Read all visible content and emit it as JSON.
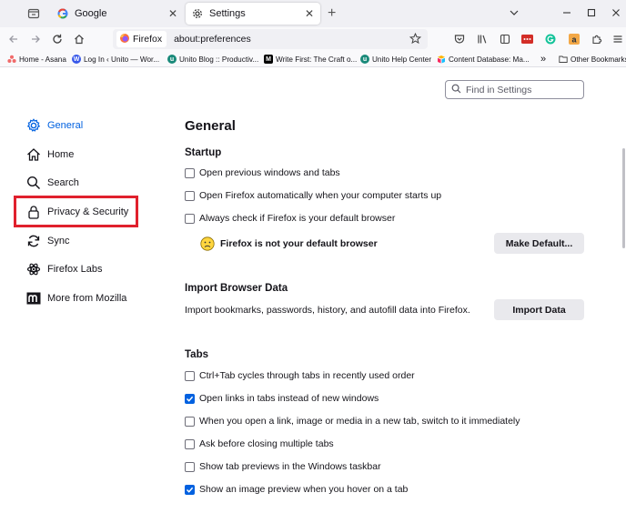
{
  "tabs": [
    {
      "label": "Google",
      "icon": "google-icon",
      "active": false
    },
    {
      "label": "Settings",
      "icon": "gear-icon",
      "active": true
    }
  ],
  "navbar": {
    "identity_label": "Firefox",
    "url": "about:preferences"
  },
  "bookmarks": [
    {
      "label": "Home - Asana",
      "icon": "asana-icon",
      "color": "#f06a6a"
    },
    {
      "label": "Log In ‹ Unito — Wor...",
      "icon": "wordpress-icon",
      "color": "#3858e9"
    },
    {
      "label": "Unito Blog :: Productiv...",
      "icon": "unito-icon",
      "color": "#1a8a7a"
    },
    {
      "label": "Write First: The Craft o...",
      "icon": "medium-icon",
      "color": "#000000"
    },
    {
      "label": "Unito Help Center",
      "icon": "unito-icon",
      "color": "#1a8a7a"
    },
    {
      "label": "Content Database: Ma...",
      "icon": "airtable-icon",
      "color": "#fcb400"
    }
  ],
  "bookmarks_other": "Other Bookmarks",
  "search": {
    "placeholder": "Find in Settings"
  },
  "sidebar": {
    "items": [
      {
        "label": "General",
        "icon": "gear-icon",
        "selected": true
      },
      {
        "label": "Home",
        "icon": "home-icon",
        "selected": false
      },
      {
        "label": "Search",
        "icon": "search-icon",
        "selected": false
      },
      {
        "label": "Privacy & Security",
        "icon": "lock-icon",
        "selected": false
      },
      {
        "label": "Sync",
        "icon": "sync-icon",
        "selected": false
      },
      {
        "label": "Firefox Labs",
        "icon": "labs-icon",
        "selected": false
      },
      {
        "label": "More from Mozilla",
        "icon": "mozilla-icon",
        "selected": false
      }
    ]
  },
  "main": {
    "title": "General",
    "startup": {
      "title": "Startup",
      "options": [
        {
          "label": "Open previous windows and tabs",
          "checked": false
        },
        {
          "label": "Open Firefox automatically when your computer starts up",
          "checked": false
        },
        {
          "label": "Always check if Firefox is your default browser",
          "checked": false
        }
      ],
      "default_status": "Firefox is not your default browser",
      "make_default_label": "Make Default..."
    },
    "import": {
      "title": "Import Browser Data",
      "description": "Import bookmarks, passwords, history, and autofill data into Firefox.",
      "button_label": "Import Data"
    },
    "tabs": {
      "title": "Tabs",
      "options": [
        {
          "label": "Ctrl+Tab cycles through tabs in recently used order",
          "checked": false
        },
        {
          "label": "Open links in tabs instead of new windows",
          "checked": true
        },
        {
          "label": "When you open a link, image or media in a new tab, switch to it immediately",
          "checked": false
        },
        {
          "label": "Ask before closing multiple tabs",
          "checked": false
        },
        {
          "label": "Show tab previews in the Windows taskbar",
          "checked": false
        },
        {
          "label": "Show an image preview when you hover on a tab",
          "checked": true
        }
      ]
    }
  },
  "colors": {
    "accent": "#0061e0",
    "highlight": "#e0202d"
  }
}
